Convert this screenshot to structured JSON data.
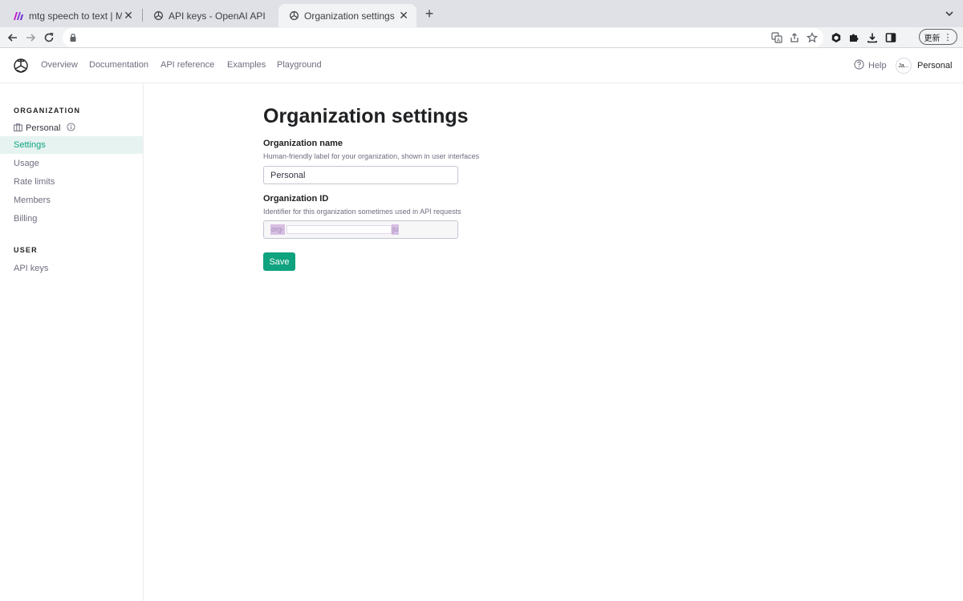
{
  "browser": {
    "tabs": [
      {
        "title": "mtg speech to text | Make",
        "active": false
      },
      {
        "title": "API keys - OpenAI API",
        "active": false
      },
      {
        "title": "Organization settings - OpenAI",
        "active": true
      }
    ],
    "update_label": "更新"
  },
  "header": {
    "nav": [
      "Overview",
      "Documentation",
      "API reference",
      "Examples",
      "Playground"
    ],
    "help_label": "Help",
    "account_label": "Personal",
    "avatar_text": "Ja..."
  },
  "sidebar": {
    "org_heading": "ORGANIZATION",
    "org_name": "Personal",
    "org_items": [
      "Settings",
      "Usage",
      "Rate limits",
      "Members",
      "Billing"
    ],
    "active_item": "Settings",
    "user_heading": "USER",
    "user_items": [
      "API keys"
    ]
  },
  "main": {
    "title": "Organization settings",
    "org_name_label": "Organization name",
    "org_name_help": "Human-friendly label for your organization, shown in user interfaces",
    "org_name_value": "Personal",
    "org_id_label": "Organization ID",
    "org_id_help": "Identifier for this organization sometimes used in API requests",
    "org_id_prefix": "org-",
    "org_id_suffix": "ju",
    "save_label": "Save"
  },
  "colors": {
    "accent": "#10a37f",
    "active_bg": "#e6f3f1",
    "selection": "#d6bfe3"
  }
}
